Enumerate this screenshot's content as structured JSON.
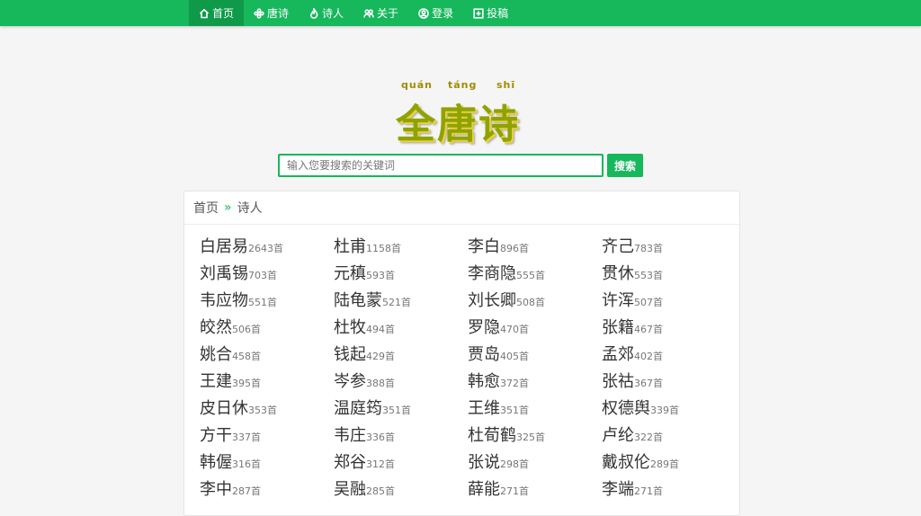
{
  "nav": {
    "items": [
      {
        "label": "首页",
        "icon": "home-icon",
        "active": true
      },
      {
        "label": "唐诗",
        "icon": "flower-icon",
        "active": false
      },
      {
        "label": "诗人",
        "icon": "flame-icon",
        "active": false
      },
      {
        "label": "关于",
        "icon": "users-icon",
        "active": false
      },
      {
        "label": "登录",
        "icon": "user-circle-icon",
        "active": false
      },
      {
        "label": "投稿",
        "icon": "plus-square-icon",
        "active": false
      }
    ]
  },
  "logo": {
    "pinyin": [
      "quán",
      "táng",
      "shī"
    ],
    "title": "全唐诗"
  },
  "search": {
    "placeholder": "输入您要搜索的关键词",
    "button_label": "搜索"
  },
  "breadcrumb": {
    "home": "首页",
    "current": "诗人"
  },
  "poets": [
    [
      [
        "白居易",
        "2643首"
      ],
      [
        "杜甫",
        "1158首"
      ],
      [
        "李白",
        "896首"
      ],
      [
        "齐己",
        "783首"
      ]
    ],
    [
      [
        "刘禹锡",
        "703首"
      ],
      [
        "元稹",
        "593首"
      ],
      [
        "李商隐",
        "555首"
      ],
      [
        "贯休",
        "553首"
      ]
    ],
    [
      [
        "韦应物",
        "551首"
      ],
      [
        "陆龟蒙",
        "521首"
      ],
      [
        "刘长卿",
        "508首"
      ],
      [
        "许浑",
        "507首"
      ]
    ],
    [
      [
        "皎然",
        "506首"
      ],
      [
        "杜牧",
        "494首"
      ],
      [
        "罗隐",
        "470首"
      ],
      [
        "张籍",
        "467首"
      ]
    ],
    [
      [
        "姚合",
        "458首"
      ],
      [
        "钱起",
        "429首"
      ],
      [
        "贾岛",
        "405首"
      ],
      [
        "孟郊",
        "402首"
      ]
    ],
    [
      [
        "王建",
        "395首"
      ],
      [
        "岑参",
        "388首"
      ],
      [
        "韩愈",
        "372首"
      ],
      [
        "张祜",
        "367首"
      ]
    ],
    [
      [
        "皮日休",
        "353首"
      ],
      [
        "温庭筠",
        "351首"
      ],
      [
        "王维",
        "351首"
      ],
      [
        "权德舆",
        "339首"
      ]
    ],
    [
      [
        "方干",
        "337首"
      ],
      [
        "韦庄",
        "336首"
      ],
      [
        "杜荀鹤",
        "325首"
      ],
      [
        "卢纶",
        "322首"
      ]
    ],
    [
      [
        "韩偓",
        "316首"
      ],
      [
        "郑谷",
        "312首"
      ],
      [
        "张说",
        "298首"
      ],
      [
        "戴叔伦",
        "289首"
      ]
    ],
    [
      [
        "李中",
        "287首"
      ],
      [
        "吴融",
        "285首"
      ],
      [
        "薛能",
        "271首"
      ],
      [
        "李端",
        "271首"
      ]
    ]
  ]
}
